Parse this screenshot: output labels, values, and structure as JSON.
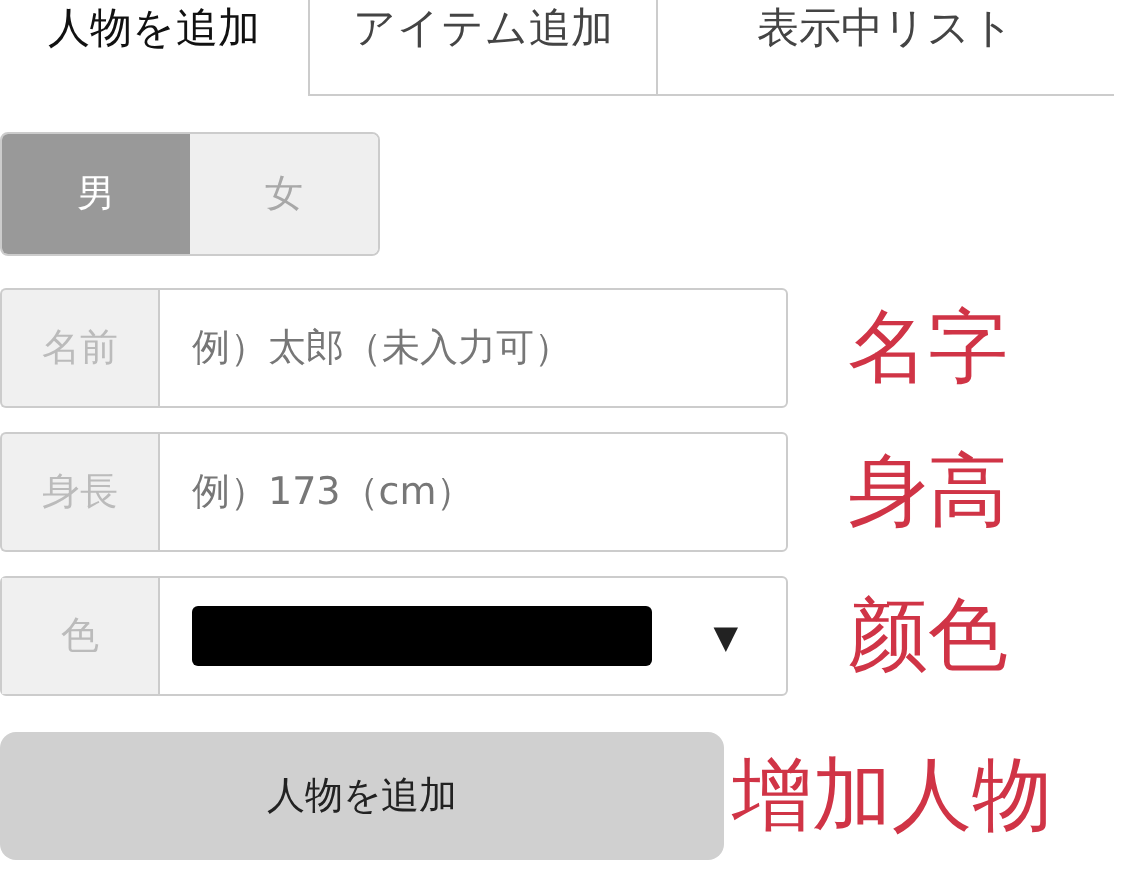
{
  "tabs": [
    {
      "label": "人物を追加",
      "selected": true
    },
    {
      "label": "アイテム追加",
      "selected": false
    },
    {
      "label": "表示中リスト",
      "selected": false
    }
  ],
  "gender": [
    {
      "label": "男",
      "selected": true
    },
    {
      "label": "女",
      "selected": false
    }
  ],
  "fields": [
    {
      "kind": "text",
      "label": "名前",
      "placeholder": "例）太郎（未入力可）",
      "note": "名字"
    },
    {
      "kind": "text",
      "label": "身長",
      "placeholder": "例）173（cm）",
      "note": "身高"
    },
    {
      "kind": "color",
      "label": "色",
      "color": "#000000",
      "arrow": "▼",
      "note": "颜色"
    }
  ],
  "submit": {
    "label": "人物を追加",
    "note": "增加人物"
  }
}
